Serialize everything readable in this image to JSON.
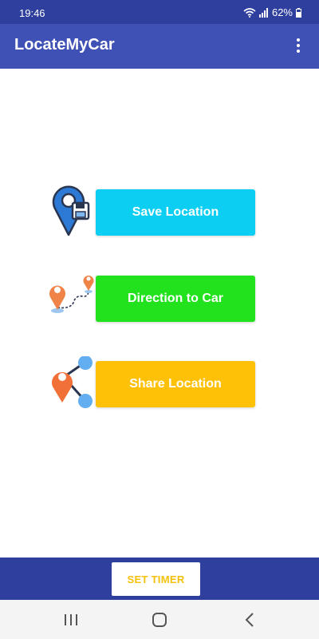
{
  "status": {
    "time": "19:46",
    "battery": "62%"
  },
  "app": {
    "title": "LocateMyCar"
  },
  "actions": {
    "save": {
      "label": "Save Location",
      "icon": "save-location-pin-icon",
      "color": "#0bcef2"
    },
    "direction": {
      "label": "Direction to Car",
      "icon": "route-pins-icon",
      "color": "#21e21d"
    },
    "share": {
      "label": "Share Location",
      "icon": "share-location-icon",
      "color": "#ffc107"
    }
  },
  "bottom": {
    "timer_label": "SET TIMER"
  },
  "colors": {
    "status_bar": "#2f3f9e",
    "app_bar": "#3f51b5",
    "bottom_bar": "#2f3f9e",
    "timer_text": "#f4c20d"
  },
  "nav": {
    "recents": "recents-icon",
    "home": "home-icon",
    "back": "back-icon"
  }
}
